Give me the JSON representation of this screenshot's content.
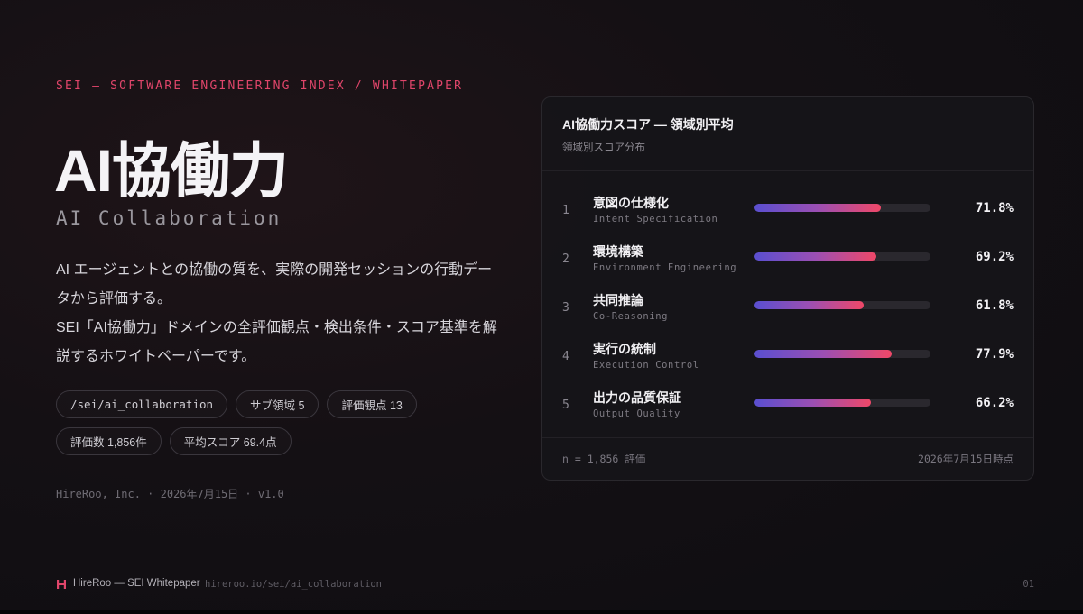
{
  "eyebrow": "SEI — SOFTWARE ENGINEERING INDEX / WHITEPAPER",
  "title": "AI協働力",
  "subtitle": "AI Collaboration",
  "description": [
    "AI エージェントとの協働の質を、実際の開発セッションの行動データから評価する。",
    "SEI「AI協働力」ドメインの全評価観点・検出条件・スコア基準を解説するホワイトペーパーです。"
  ],
  "chips": [
    "/sei/ai_collaboration",
    "サブ領域 5",
    "評価観点 13",
    "評価数 1,856件",
    "平均スコア 69.4点"
  ],
  "meta": "HireRoo, Inc. · 2026年7月15日 · v1.0",
  "card": {
    "title": "AI協働力スコア — 領域別平均",
    "subtitle": "領域別スコア分布",
    "footer_left": "n = 1,856 評価",
    "footer_right": "2026年7月15日時点"
  },
  "chart_data": {
    "type": "bar",
    "orientation": "horizontal",
    "title": "AI協働力スコア — 領域別平均",
    "subtitle": "領域別スコア分布",
    "ranks": [
      "1",
      "2",
      "3",
      "4",
      "5"
    ],
    "categories": [
      "意図の仕様化",
      "環境構築",
      "共同推論",
      "実行の統制",
      "出力の品質保証"
    ],
    "categories_en": [
      "Intent Specification",
      "Environment Engineering",
      "Co-Reasoning",
      "Execution Control",
      "Output Quality"
    ],
    "values": [
      71.8,
      69.2,
      61.8,
      77.9,
      66.2
    ],
    "value_labels": [
      "71.8%",
      "69.2%",
      "61.8%",
      "77.9%",
      "66.2%"
    ],
    "xlim": [
      0,
      100
    ],
    "bar_gradient": [
      "#5a4fd0",
      "#ef4868"
    ]
  },
  "footer": {
    "brand": "HireRoo — SEI Whitepaper",
    "url": "hireroo.io/sei/ai_collaboration",
    "page": "01"
  },
  "colors": {
    "accent": "#e0456a",
    "background": "#141014",
    "card": "#161519"
  }
}
